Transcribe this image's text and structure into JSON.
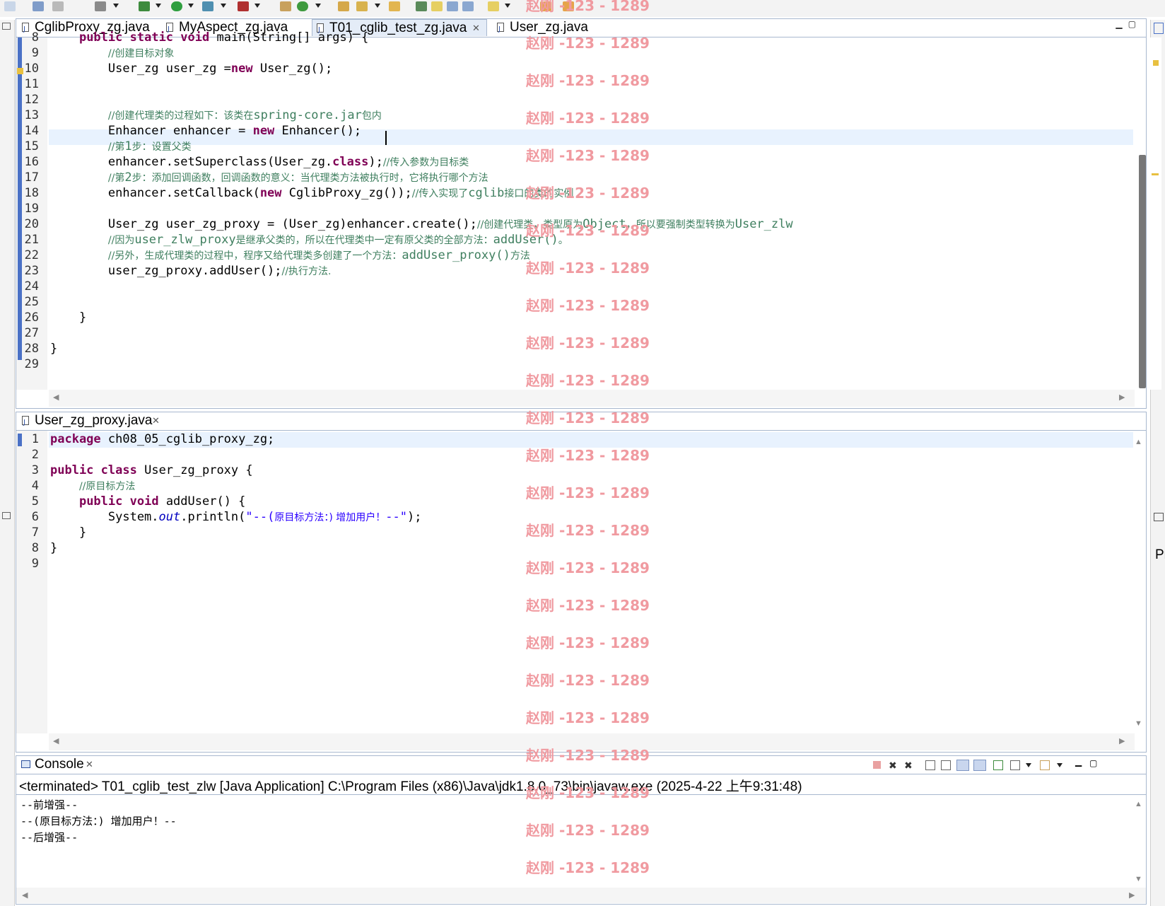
{
  "editor_top": {
    "tabs": [
      {
        "label": "CglibProxy_zg.java",
        "active": false
      },
      {
        "label": "MyAspect_zg.java",
        "active": false
      },
      {
        "label": "T01_cglib_test_zg.java",
        "active": true
      },
      {
        "label": "User_zg.java",
        "active": false
      }
    ],
    "lines": [
      {
        "n": "8",
        "html": "    <span class=\"kw\">public</span> <span class=\"kw\">static</span> <span class=\"kw\">void</span> main(String[] args) {"
      },
      {
        "n": "9",
        "html": "        <span class=\"cm\">//创建目标对象</span>"
      },
      {
        "n": "10",
        "html": "        User_zg user_zg =<span class=\"kw\">new</span> User_zg();"
      },
      {
        "n": "11",
        "html": ""
      },
      {
        "n": "12",
        "html": ""
      },
      {
        "n": "13",
        "html": "        <span class=\"cm\">//创建代理类的过程如下：该类在</span><span class=\"cmm\">spring-core.jar</span><span class=\"cm\">包内</span>"
      },
      {
        "n": "14",
        "html": "        Enhancer enhancer = <span class=\"kw\">new</span> Enhancer();"
      },
      {
        "n": "15",
        "html": "        <span class=\"cm\">//第</span><span class=\"cmm\">1</span><span class=\"cm\">步：设置父类</span>"
      },
      {
        "n": "16",
        "html": "        enhancer.setSuperclass(User_zg.<span class=\"kw\">class</span>);<span class=\"cm\">//传入参数为目标类</span>"
      },
      {
        "n": "17",
        "html": "        <span class=\"cm\">//第</span><span class=\"cmm\">2</span><span class=\"cm\">步：添加回调函数，回调函数的意义：当代理类方法被执行时，它将执行哪个方法</span>"
      },
      {
        "n": "18",
        "html": "        enhancer.setCallback(<span class=\"kw\">new</span> CglibProxy_zg());<span class=\"cm\">//传入实现了</span><span class=\"cmm\">cglib</span><span class=\"cm\">接口的类的实例</span>"
      },
      {
        "n": "19",
        "html": ""
      },
      {
        "n": "20",
        "html": "        User_zg user_zg_proxy = (User_zg)enhancer.create();<span class=\"cm\">//创建代理类，类型原为</span><span class=\"cmm\">Object</span><span class=\"cm\">，所以要强制类型转换为</span><span class=\"cmm\">User_zlw</span>"
      },
      {
        "n": "21",
        "html": "        <span class=\"cm\">//因为</span><span class=\"cmm\">user_zlw_proxy</span><span class=\"cm\">是继承父类的，所以在代理类中一定有原父类的全部方法：</span><span class=\"cmm\">addUser()</span><span class=\"cm\">。</span>"
      },
      {
        "n": "22",
        "html": "        <span class=\"cm\">//另外，生成代理类的过程中，程序又给代理类多创建了一个方法：</span><span class=\"cmm\">addUser_proxy()</span><span class=\"cm\">方法</span>"
      },
      {
        "n": "23",
        "html": "        user_zg_proxy.addUser();<span class=\"cm\">//执行方法.</span>"
      },
      {
        "n": "24",
        "html": ""
      },
      {
        "n": "25",
        "html": ""
      },
      {
        "n": "26",
        "html": "    }"
      },
      {
        "n": "27",
        "html": ""
      },
      {
        "n": "28",
        "html": "}"
      },
      {
        "n": "29",
        "html": ""
      }
    ]
  },
  "editor_bottom": {
    "tabs": [
      {
        "label": "User_zg_proxy.java",
        "active": true
      }
    ],
    "lines": [
      {
        "n": "1",
        "html": "<span class=\"kw\">package</span> ch08_05_cglib_proxy_zg;"
      },
      {
        "n": "2",
        "html": ""
      },
      {
        "n": "3",
        "html": "<span class=\"kw\">public</span> <span class=\"kw\">class</span> User_zg_proxy {"
      },
      {
        "n": "4",
        "html": "    <span class=\"cm\">//原目标方法</span>"
      },
      {
        "n": "5",
        "html": "    <span class=\"kw\">public</span> <span class=\"kw\">void</span> addUser() {"
      },
      {
        "n": "6",
        "html": "        System.<span class=\"fld\">out</span>.println(<span class=\"str\">\"--(</span><span class=\"str cm\" style=\"color:#2a00ff\">原目标方法：) 增加用户！</span><span class=\"str\">--\"</span>);"
      },
      {
        "n": "7",
        "html": "    }"
      },
      {
        "n": "8",
        "html": "}"
      },
      {
        "n": "9",
        "html": ""
      }
    ]
  },
  "console": {
    "title": "Console",
    "status": "<terminated> T01_cglib_test_zlw [Java Application] C:\\Program Files (x86)\\Java\\jdk1.8.0_73\\bin\\javaw.exe (2025-4-22 上午9:31:48)",
    "output": [
      "--前增强--",
      "--(原目标方法：) 增加用户！--",
      "--后增强--"
    ]
  },
  "watermark": {
    "text": "赵刚 -123 - 1289"
  },
  "right_panel": {
    "label": "Pr"
  },
  "colors": {
    "keyword": "#7f0055",
    "comment": "#3f7f5f",
    "string": "#2a00ff",
    "current_line": "#e8f2fe",
    "watermark": "#f09aa0"
  }
}
